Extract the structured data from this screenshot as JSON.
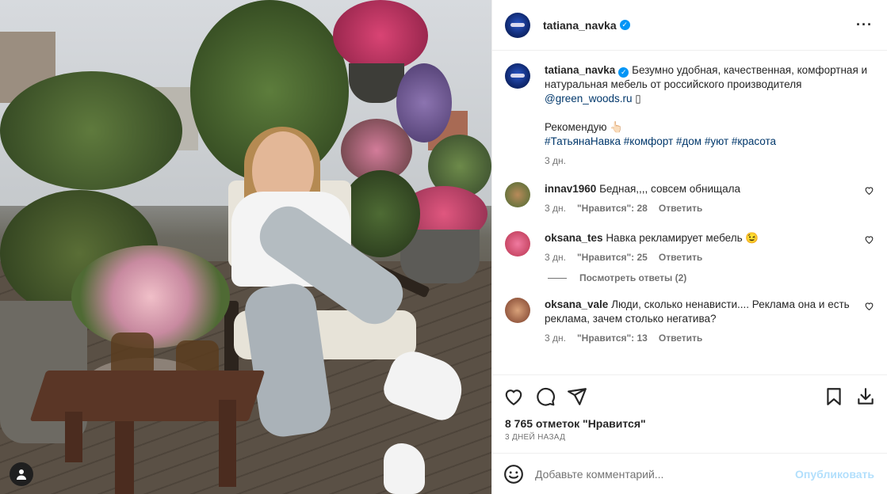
{
  "post": {
    "author": "tatiana_navka",
    "verified_mark": "✓",
    "more_icon": "more-horizontal-icon"
  },
  "caption": {
    "username": "tatiana_navka",
    "text_part1": "Безумно удобная, качественная, комфортная и натуральная мебель от российского производителя",
    "mention": "@green_woods.ru",
    "emoji_box": "▯",
    "recommend": "Рекомендую",
    "recommend_emoji": "👆🏻",
    "hashtags": [
      "#ТатьянаНавка",
      "#комфорт",
      "#дом",
      "#уют",
      "#красота"
    ],
    "time": "3 дн."
  },
  "comments": [
    {
      "username": "innav1960",
      "text": "Бедная,,,, совсем обнищала",
      "time": "3 дн.",
      "likes": "\"Нравится\": 28",
      "reply": "Ответить",
      "avatar_color": "#6b8f4e"
    },
    {
      "username": "oksana_tes",
      "text": "Навка рекламирует мебель 😉",
      "time": "3 дн.",
      "likes": "\"Нравится\": 25",
      "reply": "Ответить",
      "avatar_color": "#c94f7c"
    },
    {
      "username": "oksana_vale",
      "text": "Люди, сколько ненависти.... Реклама она и есть реклама, зачем столько негатива?",
      "time": "3 дн.",
      "likes": "\"Нравится\": 13",
      "reply": "Ответить",
      "avatar_color": "#9a6a45"
    }
  ],
  "view_replies": "Посмотреть ответы (2)",
  "likes_count": "8 765 отметок \"Нравится\"",
  "posted_when": "3 ДНЕЙ НАЗАД",
  "add_comment": {
    "placeholder": "Добавьте комментарий...",
    "post_label": "Опубликовать"
  },
  "colors": {
    "accent": "#0095f6",
    "link": "#00376b",
    "muted": "#737373",
    "post_disabled": "#b2dffc"
  }
}
